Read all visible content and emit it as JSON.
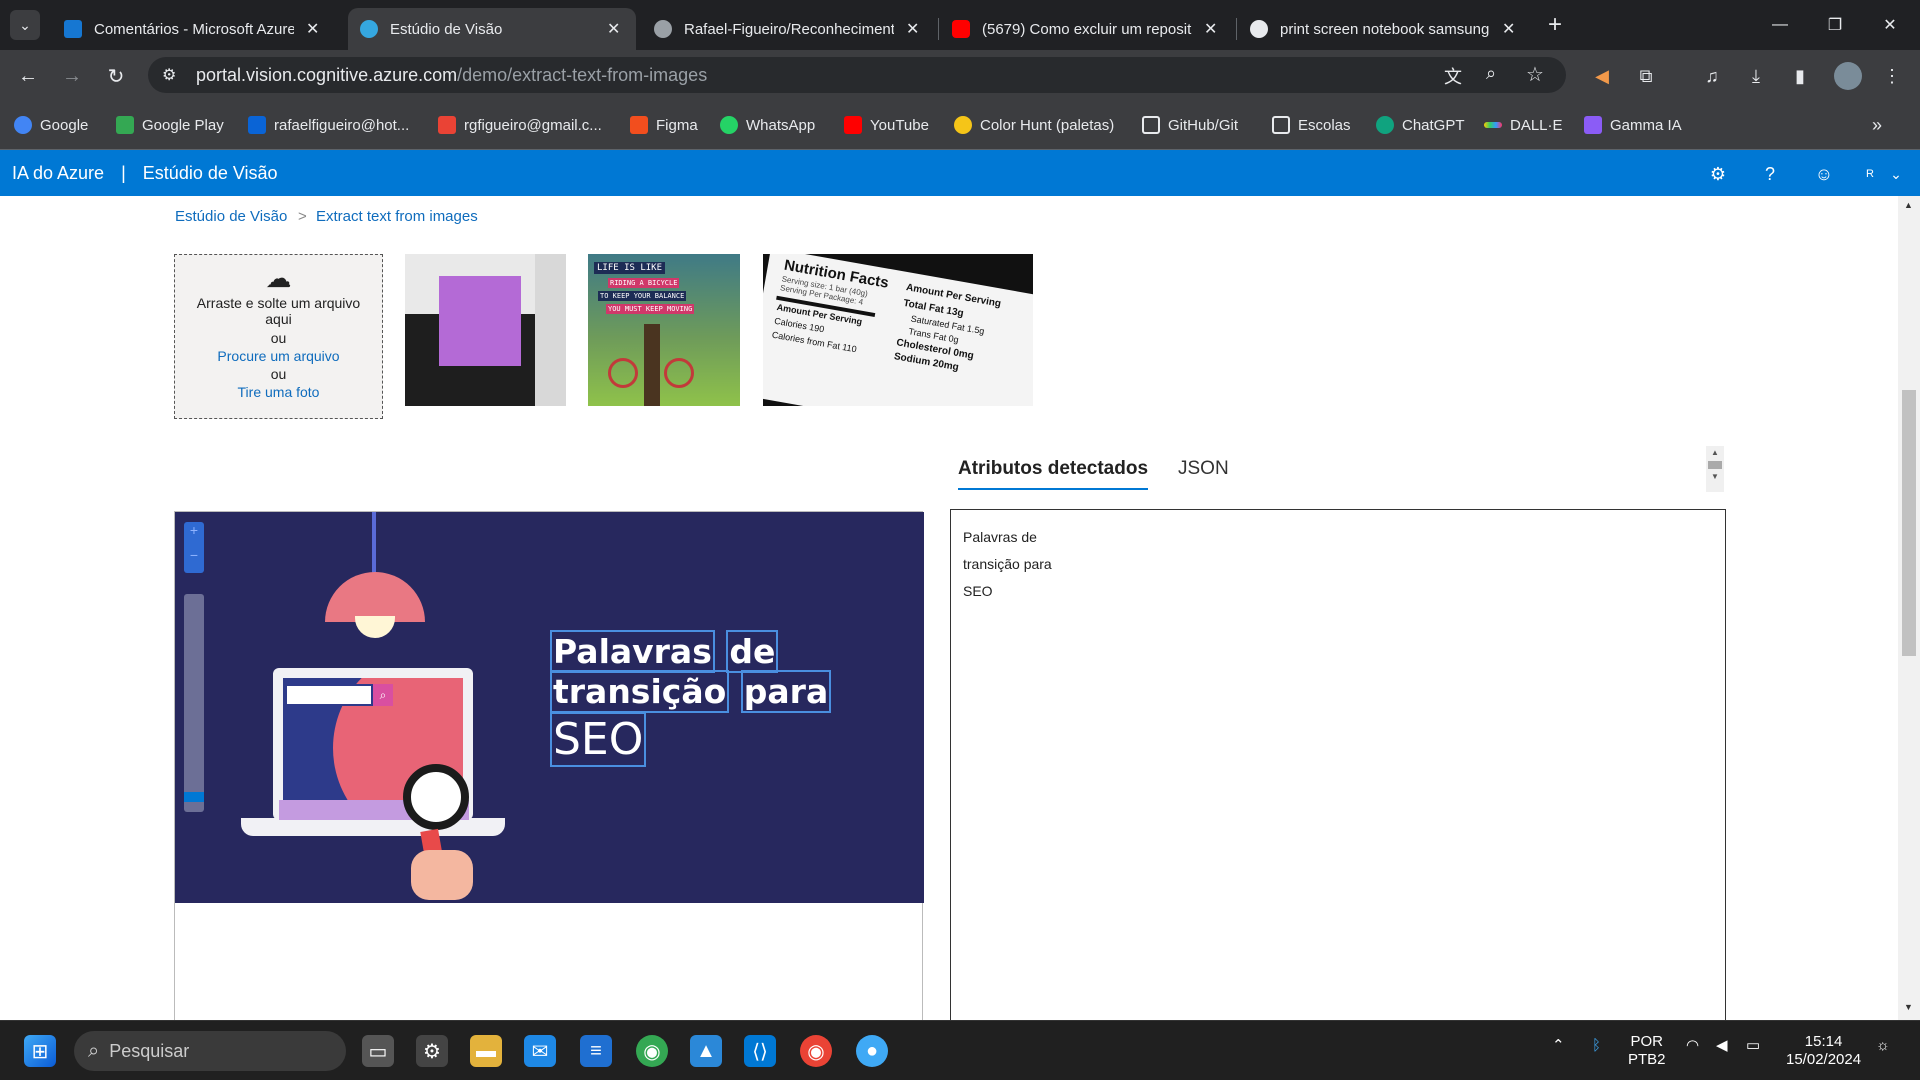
{
  "browser": {
    "tabs": [
      {
        "title": "Comentários - Microsoft Azure",
        "active": false,
        "color": "#1677d2"
      },
      {
        "title": "Estúdio de Visão",
        "active": true,
        "color": "#35a7e0"
      },
      {
        "title": "Rafael-Figueiro/Reconhecimento",
        "active": false,
        "color": "#9aa0a6"
      },
      {
        "title": "(5679) Como excluir um reposit",
        "active": false,
        "color": "#ff0000"
      },
      {
        "title": "print screen notebook samsung",
        "active": false,
        "color": "#e8eaed"
      }
    ],
    "new_tab_label": "+",
    "url_host": "portal.vision.cognitive.azure.com",
    "url_path": "/demo/extract-text-from-images",
    "bookmarks": [
      {
        "label": "Google",
        "color": "#4285f4"
      },
      {
        "label": "Google Play",
        "color": "#34a853"
      },
      {
        "label": "rafaelfigueiro@hot...",
        "color": "#0a64d6"
      },
      {
        "label": "rgfigueiro@gmail.c...",
        "color": "#ea4335"
      },
      {
        "label": "Figma",
        "color": "#f24e1e"
      },
      {
        "label": "WhatsApp",
        "color": "#25d366"
      },
      {
        "label": "YouTube",
        "color": "#ff0000"
      },
      {
        "label": "Color Hunt (paletas)",
        "color": "#f5c518"
      },
      {
        "label": "GitHub/Git",
        "color": "#e8eaed"
      },
      {
        "label": "Escolas",
        "color": "#e8eaed"
      },
      {
        "label": "ChatGPT",
        "color": "#10a37f"
      },
      {
        "label": "DALL·E",
        "color": "#ffcc00"
      },
      {
        "label": "Gamma IA",
        "color": "#8b5cf6"
      }
    ]
  },
  "azure": {
    "product": "IA do Azure",
    "separator": "|",
    "studio": "Estúdio de Visão",
    "user_initial": "R"
  },
  "breadcrumb": {
    "root": "Estúdio de Visão",
    "sep": ">",
    "current": "Extract text from images"
  },
  "dropzone": {
    "line1": "Arraste e solte um arquivo aqui",
    "or1": "ou",
    "browse": "Procure um arquivo",
    "or2": "ou",
    "photo": "Tire uma foto"
  },
  "samples": {
    "bicycle_line1": "LIFE IS LIKE",
    "bicycle_line2": "RIDING A BICYCLE",
    "bicycle_line3": "TO KEEP YOUR BALANCE",
    "bicycle_line4": "YOU MUST KEEP MOVING",
    "nutrition_title": "Nutrition Facts",
    "nutrition_l1": "Serving size: 1 bar (40g)",
    "nutrition_l2": "Serving Per Package: 4",
    "nutrition_l3": "Amount Per Serving",
    "nutrition_l4": "Calories 190",
    "nutrition_l5": "Calories from Fat 110",
    "nutrition_r1": "Amount Per Serving",
    "nutrition_r2": "Total Fat 13g",
    "nutrition_r3": "Saturated Fat 1.5g",
    "nutrition_r4": "Trans Fat 0g",
    "nutrition_r5": "Cholesterol 0mg",
    "nutrition_r6": "Sodium 20mg"
  },
  "result_tabs": {
    "attributes": "Atributos detectados",
    "json": "JSON"
  },
  "detected_lines": [
    "Palavras de",
    "transição para",
    "SEO"
  ],
  "main_image": {
    "line1_word1": "Palavras",
    "line1_word2": "de",
    "line2_word1": "transição",
    "line2_word2": "para",
    "line3": "SEO"
  },
  "taskbar": {
    "search_placeholder": "Pesquisar",
    "lang": "POR",
    "layout": "PTB2",
    "time": "15:14",
    "date": "15/02/2024"
  }
}
